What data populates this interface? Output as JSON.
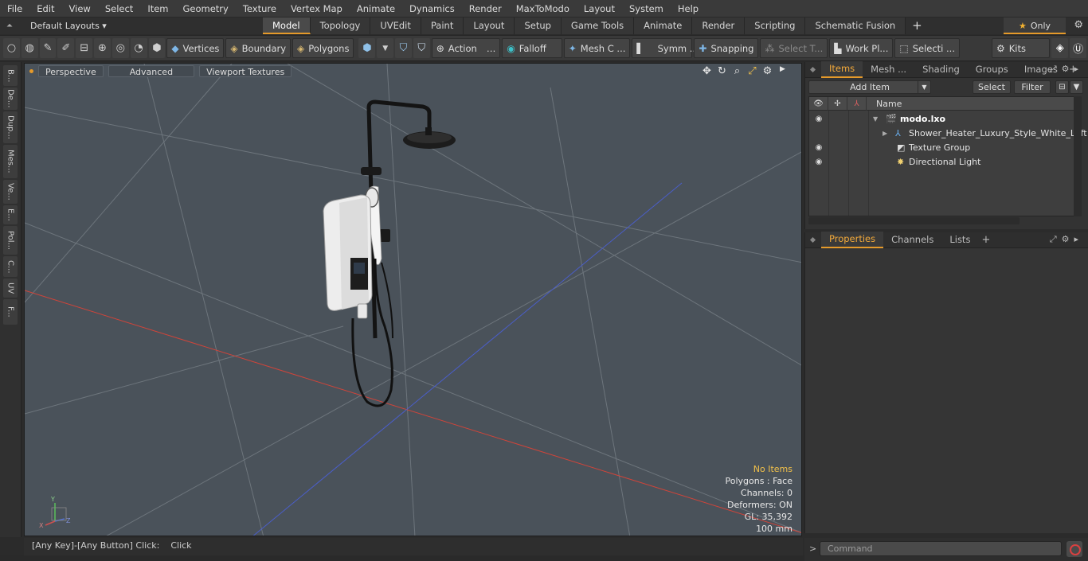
{
  "menu": [
    "File",
    "Edit",
    "View",
    "Select",
    "Item",
    "Geometry",
    "Texture",
    "Vertex Map",
    "Animate",
    "Dynamics",
    "Render",
    "MaxToModo",
    "Layout",
    "System",
    "Help"
  ],
  "layout_bar": {
    "layouts_label": "Default Layouts ▾",
    "tabs": [
      "Model",
      "Topology",
      "UVEdit",
      "Paint",
      "Layout",
      "Setup",
      "Game Tools",
      "Animate",
      "Render",
      "Scripting",
      "Schematic Fusion"
    ],
    "active_tab": "Model",
    "only_label": "Only"
  },
  "toolbar": {
    "vertices": "Vertices",
    "boundary": "Boundary",
    "polygons": "Polygons",
    "action": "Action",
    "falloff": "Falloff",
    "mesh": "Mesh C ...",
    "symmetry": "Symm ...",
    "snapping": "Snapping",
    "select_t": "Select T...",
    "work_plane": "Work Pl...",
    "selection": "Selecti ...",
    "kits": "Kits"
  },
  "left_tabs": [
    "B...",
    "De...",
    "Dup...",
    "Mes...",
    "Ve...",
    "E...",
    "Pol...",
    "C...",
    "UV",
    "F..."
  ],
  "viewport": {
    "perspective": "Perspective",
    "advanced": "Advanced",
    "textures": "Viewport Textures",
    "stats": {
      "selection": "No Items",
      "polygons": "Polygons : Face",
      "channels": "Channels: 0",
      "deformers": "Deformers: ON",
      "gl": "GL: 35,392",
      "unit": "100 mm"
    }
  },
  "status": {
    "key": "[Any Key]-[Any Button] Click:",
    "action": "Click"
  },
  "items_panel": {
    "tabs": [
      "Items",
      "Mesh ...",
      "Shading",
      "Groups",
      "Images"
    ],
    "active_tab": "Items",
    "add_item": "Add Item",
    "select": "Select",
    "filter": "Filter",
    "column_name": "Name",
    "rows": [
      {
        "label": "modo.lxo",
        "level": 0
      },
      {
        "label": "Shower_Heater_Luxury_Style_White_Left",
        "level": 1
      },
      {
        "label": "Texture Group",
        "level": 1
      },
      {
        "label": "Directional Light",
        "level": 1
      }
    ]
  },
  "props_panel": {
    "tabs": [
      "Properties",
      "Channels",
      "Lists"
    ],
    "active_tab": "Properties"
  },
  "command": {
    "placeholder": "Command"
  },
  "colors": {
    "accent": "#e59a2a",
    "viewport_bg": "#4a525a",
    "x_axis": "#d0443a",
    "z_axis": "#4a5ec8",
    "highlight_text": "#f2c14a"
  }
}
